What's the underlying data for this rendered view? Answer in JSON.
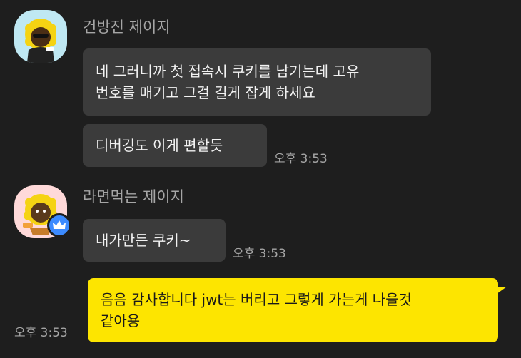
{
  "messages": [
    {
      "sender": "건방진 제이지",
      "avatar_icon": "jay-g-sunglasses-avatar-icon",
      "bubbles": [
        {
          "lines": [
            "네 그러니까 첫 접속시 쿠키를 남기는데 고유",
            "번호를 매기고 그걸 길게 잡게 하세요"
          ]
        },
        {
          "lines": [
            "디버깅도 이게 편할듯"
          ],
          "time": "오후 3:53"
        }
      ]
    },
    {
      "sender": "라면먹는 제이지",
      "avatar_icon": "jay-g-ramen-avatar-icon",
      "badge_icon": "crown-icon",
      "bubbles": [
        {
          "lines": [
            "내가만든 쿠키~"
          ],
          "time": "오후 3:53"
        }
      ]
    }
  ],
  "my_message": {
    "lines": [
      "음음 감사합니다 jwt는 버리고 그렇게 가는게 나을것",
      "같아용"
    ],
    "time": "오후 3:53"
  },
  "colors": {
    "background": "#1e1e1e",
    "other_bubble": "#3b3b3b",
    "my_bubble": "#fde500",
    "name_text": "#a6a6a6",
    "badge": "#3d8bff"
  }
}
